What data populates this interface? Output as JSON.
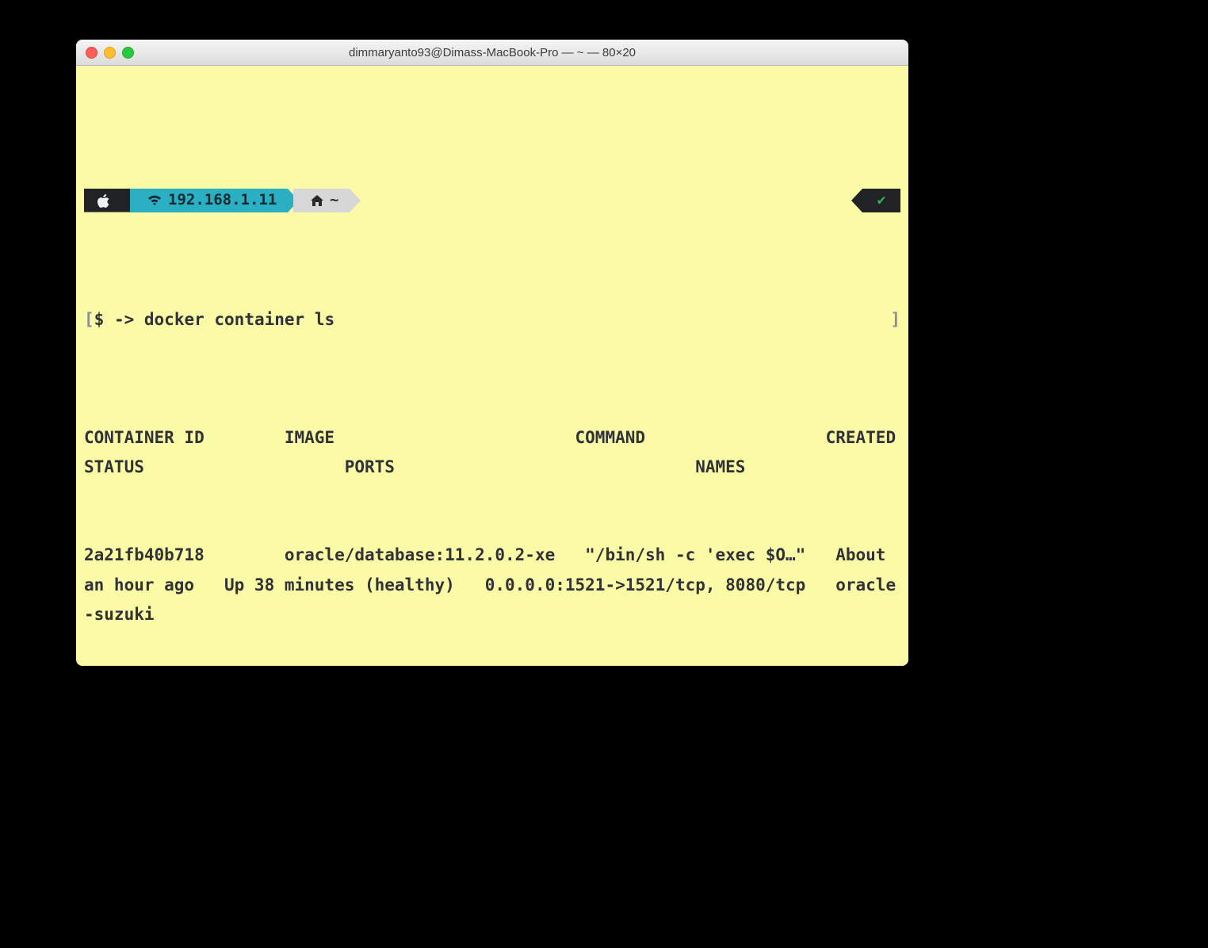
{
  "window": {
    "title": "dimmaryanto93@Dimass-MacBook-Pro — ~ — 80×20"
  },
  "prompt": {
    "host_ip": "192.168.1.11",
    "path": "~",
    "ps1": "$ ->",
    "left_bracket": "[",
    "right_bracket": "]"
  },
  "cmd1": "docker container ls",
  "output_headers": "CONTAINER ID        IMAGE                        COMMAND                  CREATED             STATUS                    PORTS                              NAMES",
  "output_row": "2a21fb40b718        oracle/database:11.2.0.2-xe   \"/bin/sh -c 'exec $O…\"   About an hour ago   Up 38 minutes (healthy)   0.0.0.0:1521->1521/tcp, 8080/tcp   oracle-suzuki",
  "cmd2": ""
}
